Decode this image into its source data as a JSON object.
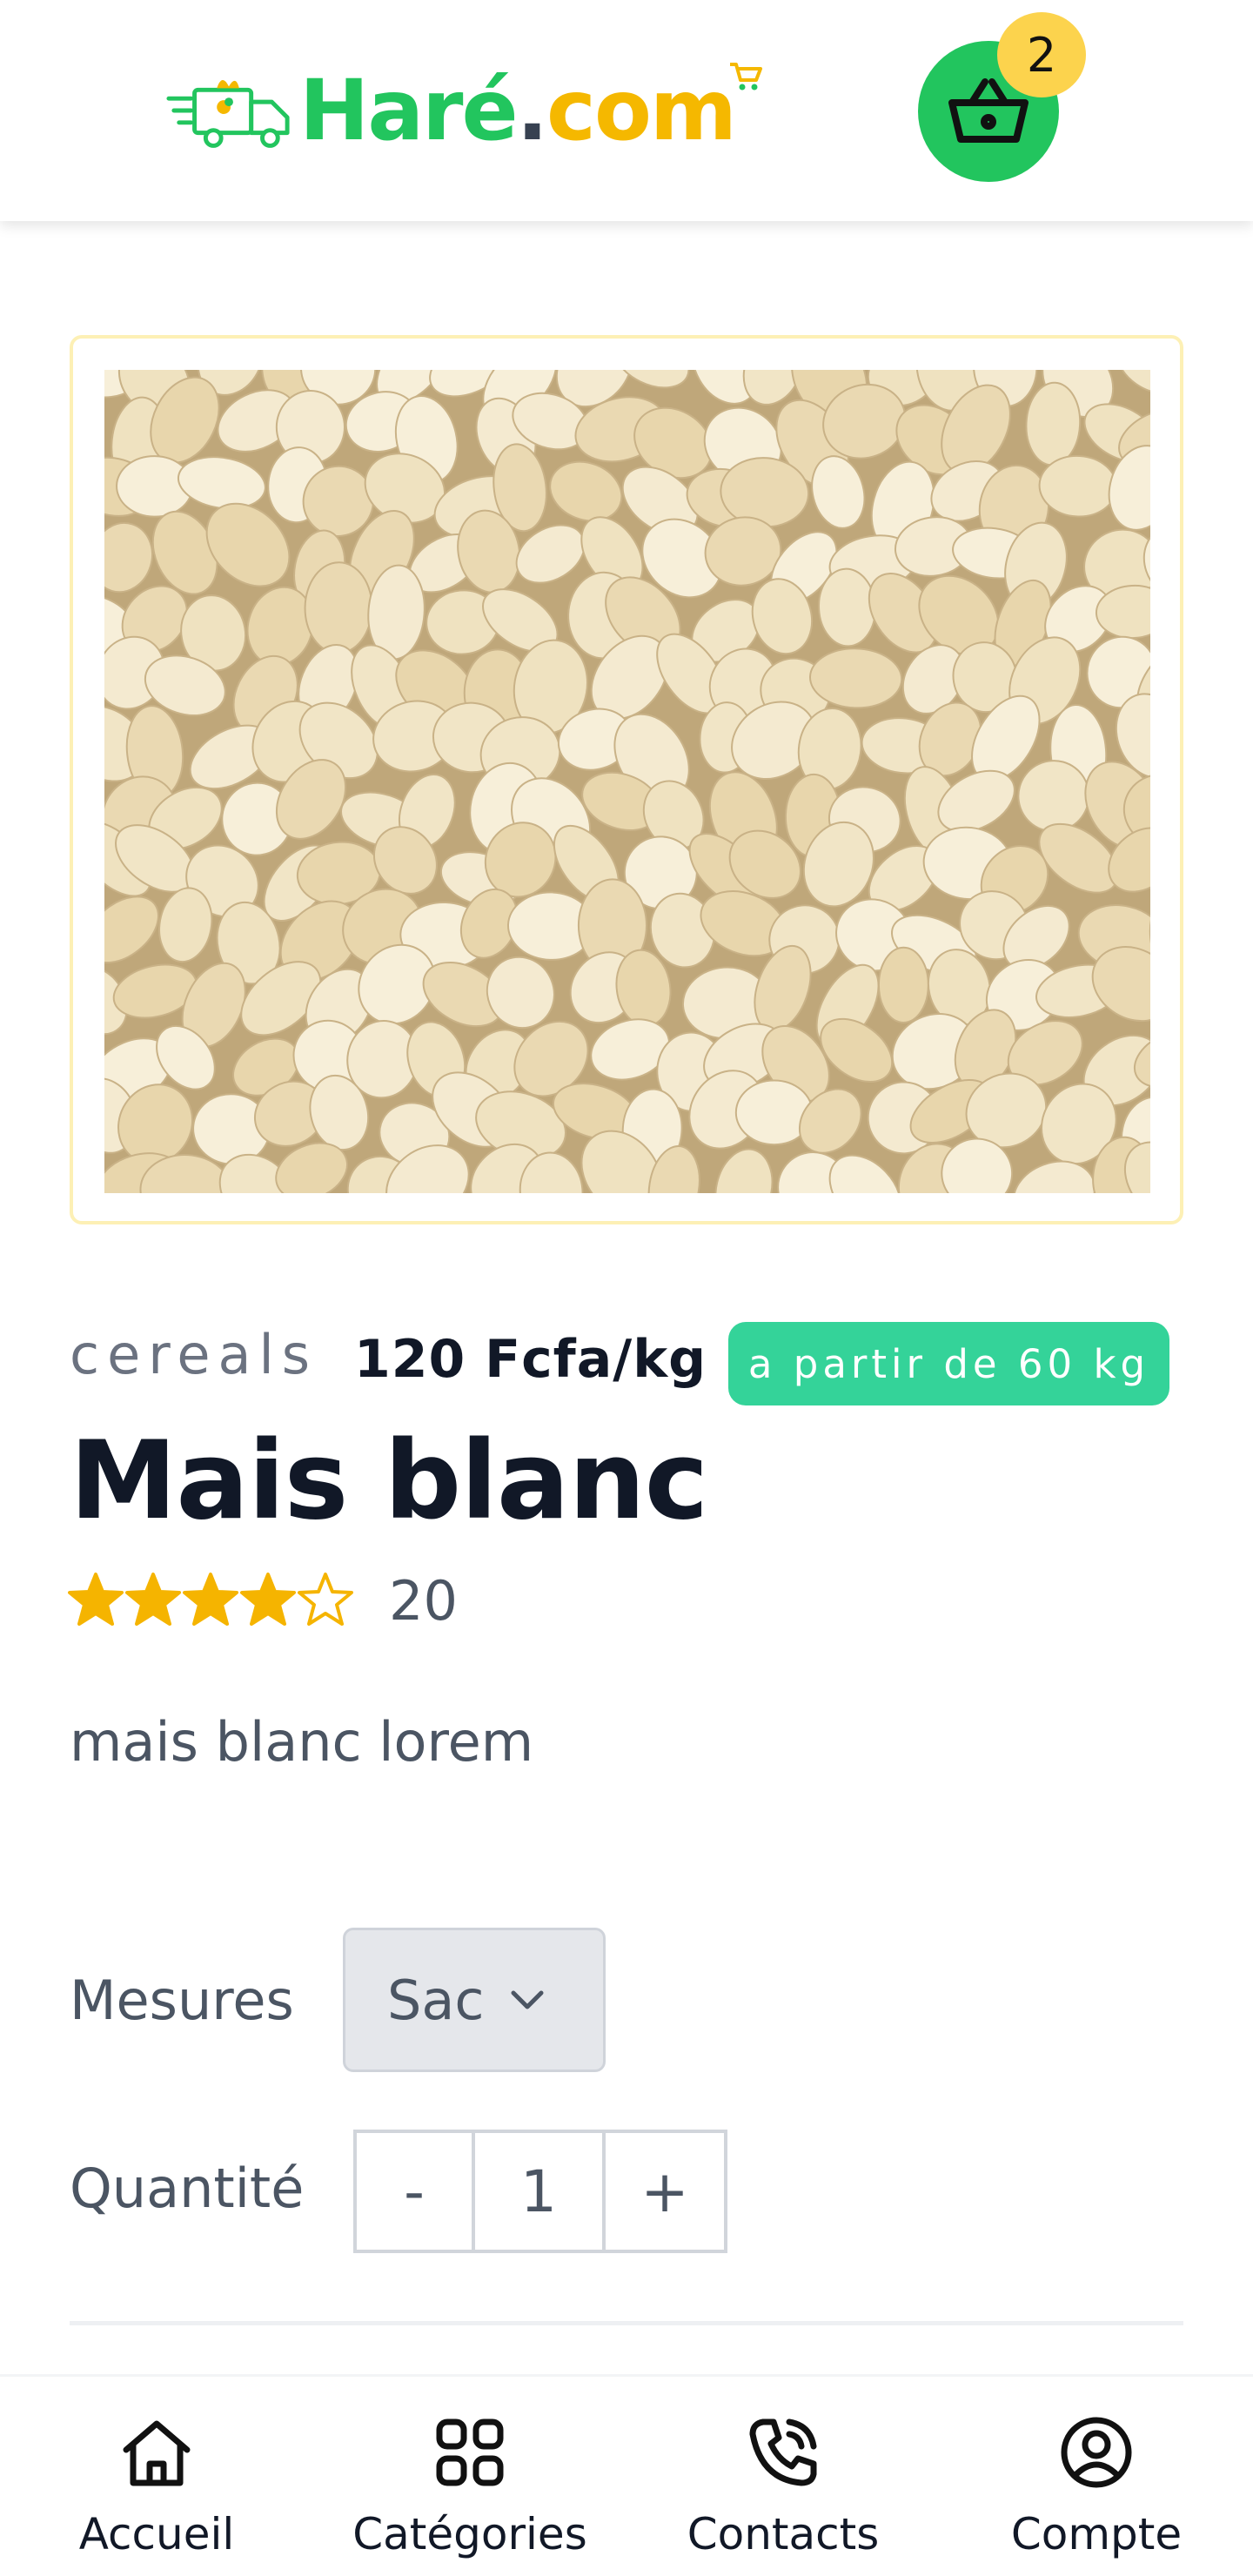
{
  "header": {
    "logo": {
      "brand_word": "Haré",
      "dot": ".",
      "suffix": "com"
    },
    "cart_count": "2",
    "icons": {
      "logo": "delivery-truck-icon",
      "cart": "basket-icon"
    }
  },
  "product": {
    "image_alt": "Mais blanc",
    "category": "cereals",
    "price": "120 Fcfa/kg",
    "min_order": "a partir de 60 kg",
    "title": "Mais blanc",
    "rating": 4,
    "rating_max": 5,
    "review_count": "20",
    "description": "mais blanc lorem"
  },
  "options": {
    "measures_label": "Mesures",
    "measure_selected": "Sac",
    "quantity_label": "Quantité",
    "quantity_minus": "-",
    "quantity_value": "1",
    "quantity_plus": "+"
  },
  "bottom_nav": [
    {
      "label": "Accueil",
      "icon": "home-icon"
    },
    {
      "label": "Catégories",
      "icon": "grid-icon"
    },
    {
      "label": "Contacts",
      "icon": "phone-icon"
    },
    {
      "label": "Compte",
      "icon": "user-icon"
    }
  ],
  "colors": {
    "brand_green": "#22c55e",
    "brand_yellow": "#f5b800",
    "badge_green": "#34d399",
    "star": "#f5b400"
  }
}
